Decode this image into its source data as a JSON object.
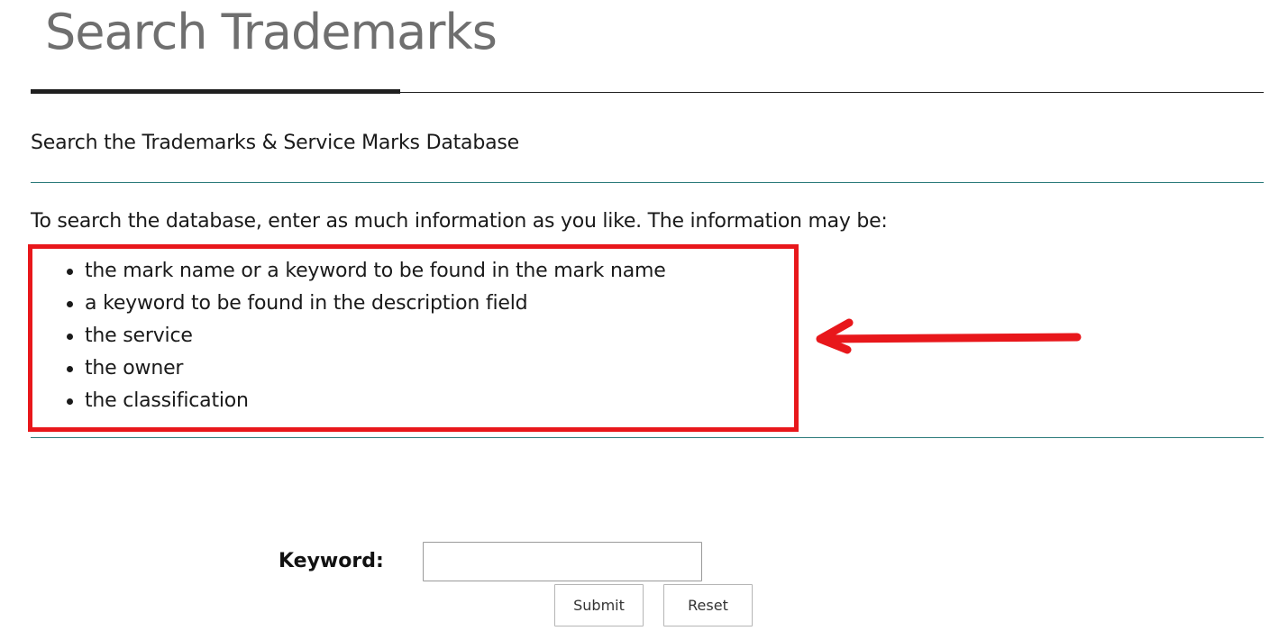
{
  "header": {
    "title": "Search Trademarks"
  },
  "section": {
    "subtitle": "Search the Trademarks & Service Marks Database",
    "intro": "To search the database, enter as much information as you like. The information may be:",
    "criteria": [
      "the mark name or a keyword to be found in the mark name",
      "a keyword to be found in the description field",
      "the service",
      "the owner",
      "the classification"
    ]
  },
  "annotation": {
    "box_color": "#e8171b",
    "arrow_color": "#e8171b",
    "arrow_icon": "left-arrow-icon"
  },
  "form": {
    "keyword_label": "Keyword:",
    "keyword_value": "",
    "submit_label": "Submit",
    "reset_label": "Reset"
  },
  "colors": {
    "title": "#6f6f6f",
    "rule_dark": "#1f1f1f",
    "rule_teal": "#2b7a7a"
  }
}
